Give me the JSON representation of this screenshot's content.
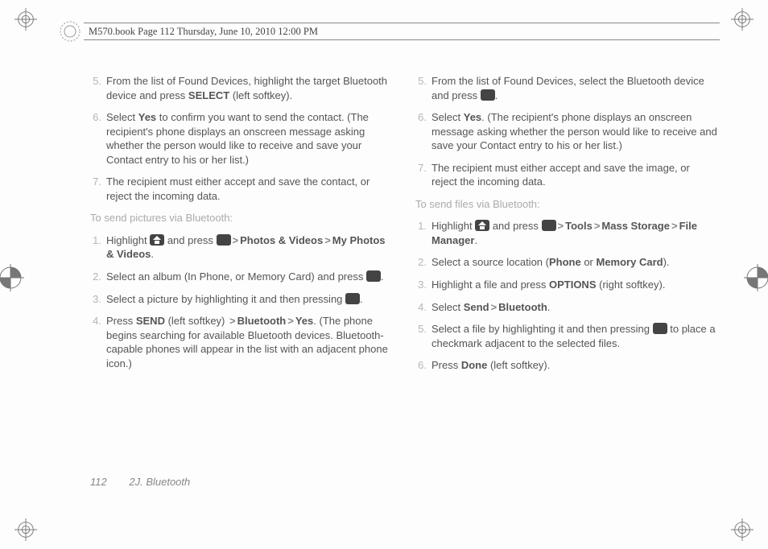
{
  "header": "M570.book  Page 112  Thursday, June 10, 2010  12:00 PM",
  "footer": {
    "page": "112",
    "section": "2J. Bluetooth"
  },
  "left": {
    "items5": {
      "num": "5.",
      "t1": "From the list of Found Devices, highlight the target Bluetooth device and press ",
      "b1": "SELECT",
      "t2": " (left softkey)."
    },
    "items6": {
      "num": "6.",
      "t1": "Select ",
      "b1": "Yes",
      "t2": " to confirm you want to send the contact. (The recipient's phone displays an onscreen message asking whether the person would like to receive and save your Contact entry to his or her list.)"
    },
    "items7": {
      "num": "7.",
      "t1": "The recipient must either accept and save the contact, or reject the incoming data."
    },
    "subhead": "To send pictures via Bluetooth:",
    "p1": {
      "num": "1.",
      "t1": "Highlight ",
      "t2": " and press ",
      "b1": "Photos & Videos",
      "b2": "My Photos & Videos",
      "t3": "."
    },
    "p2": {
      "num": "2.",
      "t1": "Select an album (In Phone, or Memory Card) and press ",
      "t2": "."
    },
    "p3": {
      "num": "3.",
      "t1": "Select a picture by highlighting it and then pressing ",
      "t2": "."
    },
    "p4": {
      "num": "4.",
      "t1": "Press ",
      "b1": "SEND",
      "t2": " (left softkey) ",
      "b2": "Bluetooth",
      "b3": "Yes",
      "t3": ". (The phone begins searching for available Bluetooth devices. Bluetooth-capable phones will appear in the list with an adjacent phone icon.)"
    }
  },
  "right": {
    "items5": {
      "num": "5.",
      "t1": "From the list of Found Devices, select the Bluetooth device and press ",
      "t2": "."
    },
    "items6": {
      "num": "6.",
      "t1": "Select ",
      "b1": "Yes",
      "t2": ". (The recipient's phone displays an onscreen message asking whether the person would like to receive and save your Contact entry to his or her list.)"
    },
    "items7": {
      "num": "7.",
      "t1": "The recipient must either accept and save the image, or reject the incoming data."
    },
    "subhead": "To send files via Bluetooth:",
    "f1": {
      "num": "1.",
      "t1": "Highlight ",
      "t2": " and press ",
      "b1": "Tools",
      "b2": "Mass Storage",
      "b3": "File Manager",
      "t3": "."
    },
    "f2": {
      "num": "2.",
      "t1": "Select a source location (",
      "b1": "Phone",
      "t2": " or ",
      "b2": "Memory Card",
      "t3": ")."
    },
    "f3": {
      "num": "3.",
      "t1": "Highlight a file and press ",
      "b1": "OPTIONS",
      "t2": " (right softkey)."
    },
    "f4": {
      "num": "4.",
      "t1": "Select ",
      "b1": "Send",
      "b2": "Bluetooth",
      "t2": "."
    },
    "f5": {
      "num": "5.",
      "t1": "Select a file by highlighting it and then pressing ",
      "t2": " to place a checkmark adjacent to the selected files."
    },
    "f6": {
      "num": "6.",
      "t1": "Press ",
      "b1": "Done",
      "t2": " (left softkey)."
    }
  }
}
